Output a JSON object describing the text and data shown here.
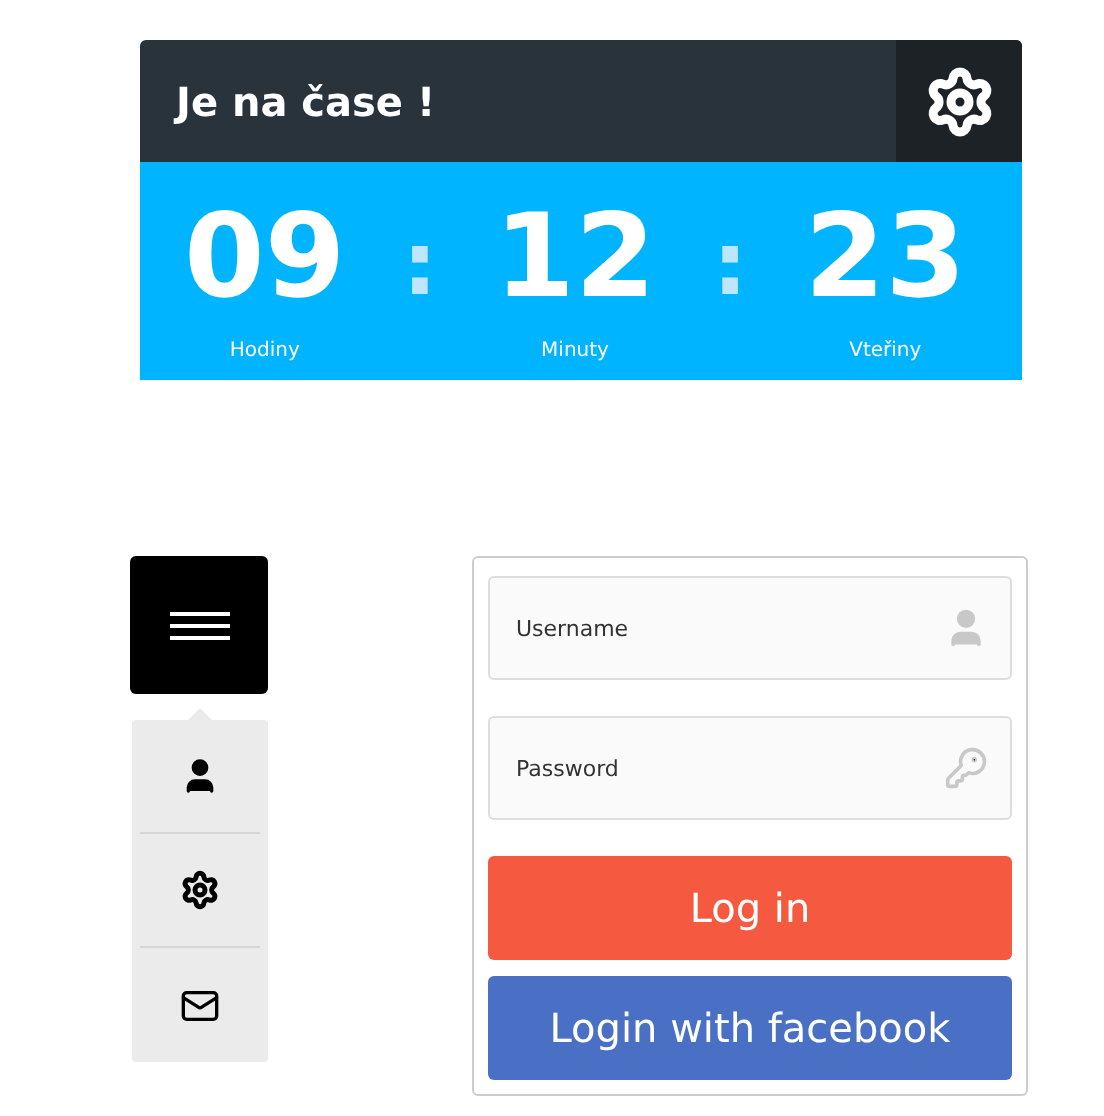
{
  "clock": {
    "title": "Je na čase !",
    "units": [
      {
        "value": "09",
        "label": "Hodiny"
      },
      {
        "value": "12",
        "label": "Minuty"
      },
      {
        "value": "23",
        "label": "Vteřiny"
      }
    ],
    "separator": ":"
  },
  "menu": {
    "items": [
      {
        "kind": "user"
      },
      {
        "kind": "settings"
      },
      {
        "kind": "mail"
      }
    ]
  },
  "login": {
    "fields": [
      {
        "placeholder": "Username",
        "kind": "user"
      },
      {
        "placeholder": "Password",
        "kind": "key"
      }
    ],
    "buttons": [
      {
        "label": "Log in",
        "kind": "primary"
      },
      {
        "label": "Login with facebook",
        "kind": "facebook"
      }
    ]
  }
}
